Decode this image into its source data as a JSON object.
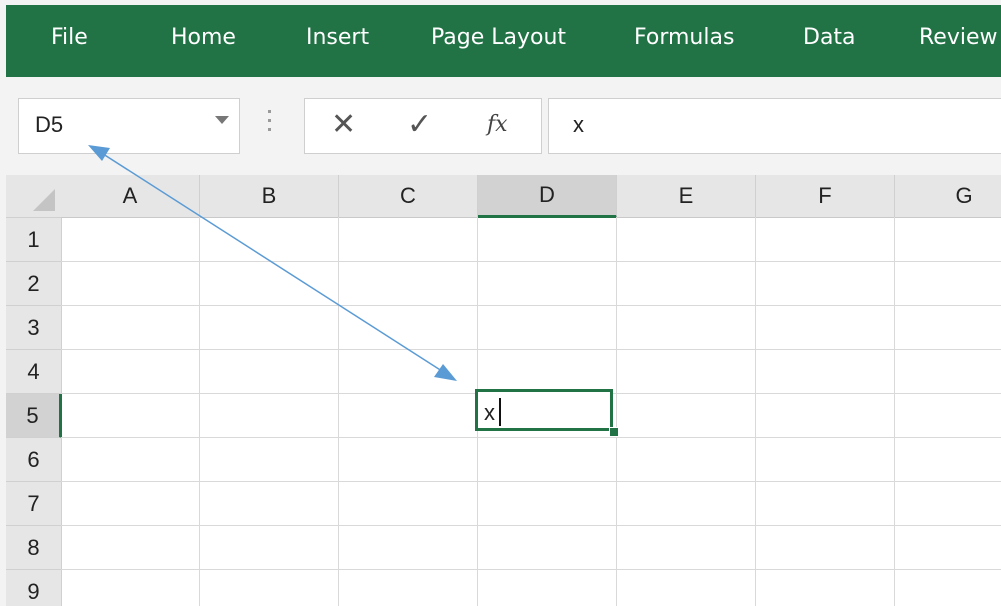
{
  "ribbon": {
    "tabs": [
      "File",
      "Home",
      "Insert",
      "Page Layout",
      "Formulas",
      "Data",
      "Review"
    ]
  },
  "formula_bar": {
    "name_box": "D5",
    "cancel_icon": "✕",
    "enter_icon": "✓",
    "function_label": "fx",
    "formula_value": "x"
  },
  "sheet": {
    "columns": [
      "A",
      "B",
      "C",
      "D",
      "E",
      "F",
      "G"
    ],
    "rows": [
      "1",
      "2",
      "3",
      "4",
      "5",
      "6",
      "7",
      "8",
      "9"
    ],
    "selected_column": "D",
    "selected_row": "5",
    "active_cell_value": "x"
  },
  "colors": {
    "ribbon": "#217346",
    "accent": "#217346",
    "annotation_arrow": "#5b9bd5"
  }
}
